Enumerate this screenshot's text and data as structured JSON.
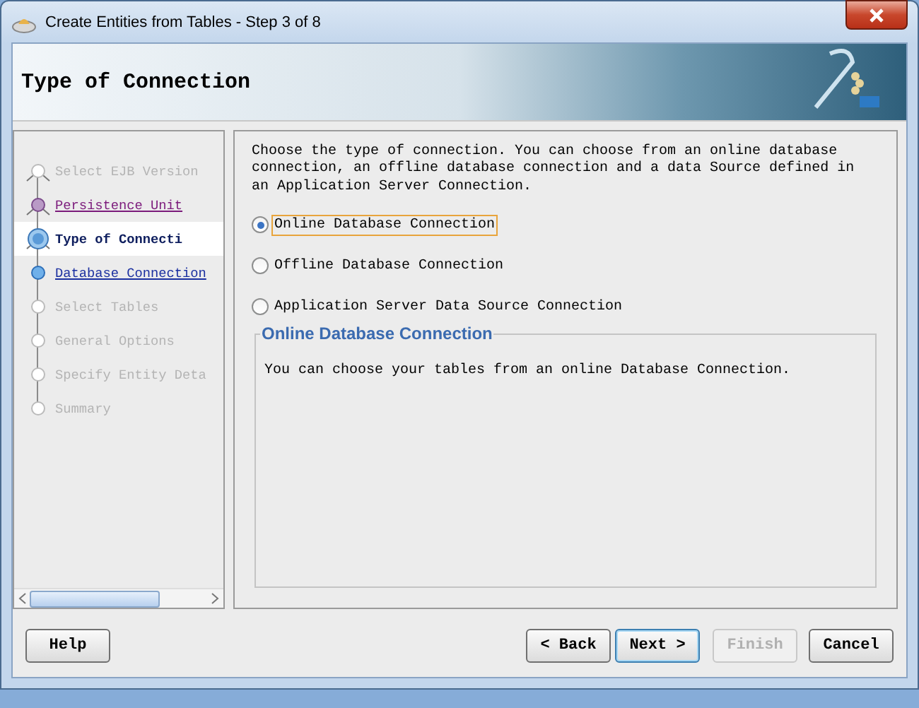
{
  "window": {
    "title": "Create Entities from Tables - Step 3 of 8"
  },
  "header": {
    "title": "Type of Connection"
  },
  "steps": [
    {
      "label": "Select EJB Version",
      "kind": "disabled"
    },
    {
      "label": "Persistence Unit",
      "kind": "visited"
    },
    {
      "label": "Type of Connecti",
      "kind": "current"
    },
    {
      "label": "Database Connection",
      "kind": "link"
    },
    {
      "label": "Select Tables",
      "kind": "disabled"
    },
    {
      "label": "General Options",
      "kind": "disabled"
    },
    {
      "label": "Specify Entity Deta",
      "kind": "disabled"
    },
    {
      "label": "Summary",
      "kind": "disabled"
    }
  ],
  "description": "Choose the type of connection. You can choose from an online database connection, an offline database connection and a data Source defined in an Application Server Connection.",
  "options": [
    {
      "label": "Online Database Connection",
      "selected": true
    },
    {
      "label": "Offline Database Connection",
      "selected": false
    },
    {
      "label": "Application Server Data Source Connection",
      "selected": false
    }
  ],
  "group": {
    "title": "Online Database Connection",
    "text": "You can choose your tables from an online Database Connection."
  },
  "buttons": [
    {
      "label": "Help",
      "disabled": false,
      "default": false
    },
    {
      "label": "< Back",
      "disabled": false,
      "default": false
    },
    {
      "label": "Next >",
      "disabled": false,
      "default": true
    },
    {
      "label": "Finish",
      "disabled": true,
      "default": false
    },
    {
      "label": "Cancel",
      "disabled": false,
      "default": false
    }
  ]
}
